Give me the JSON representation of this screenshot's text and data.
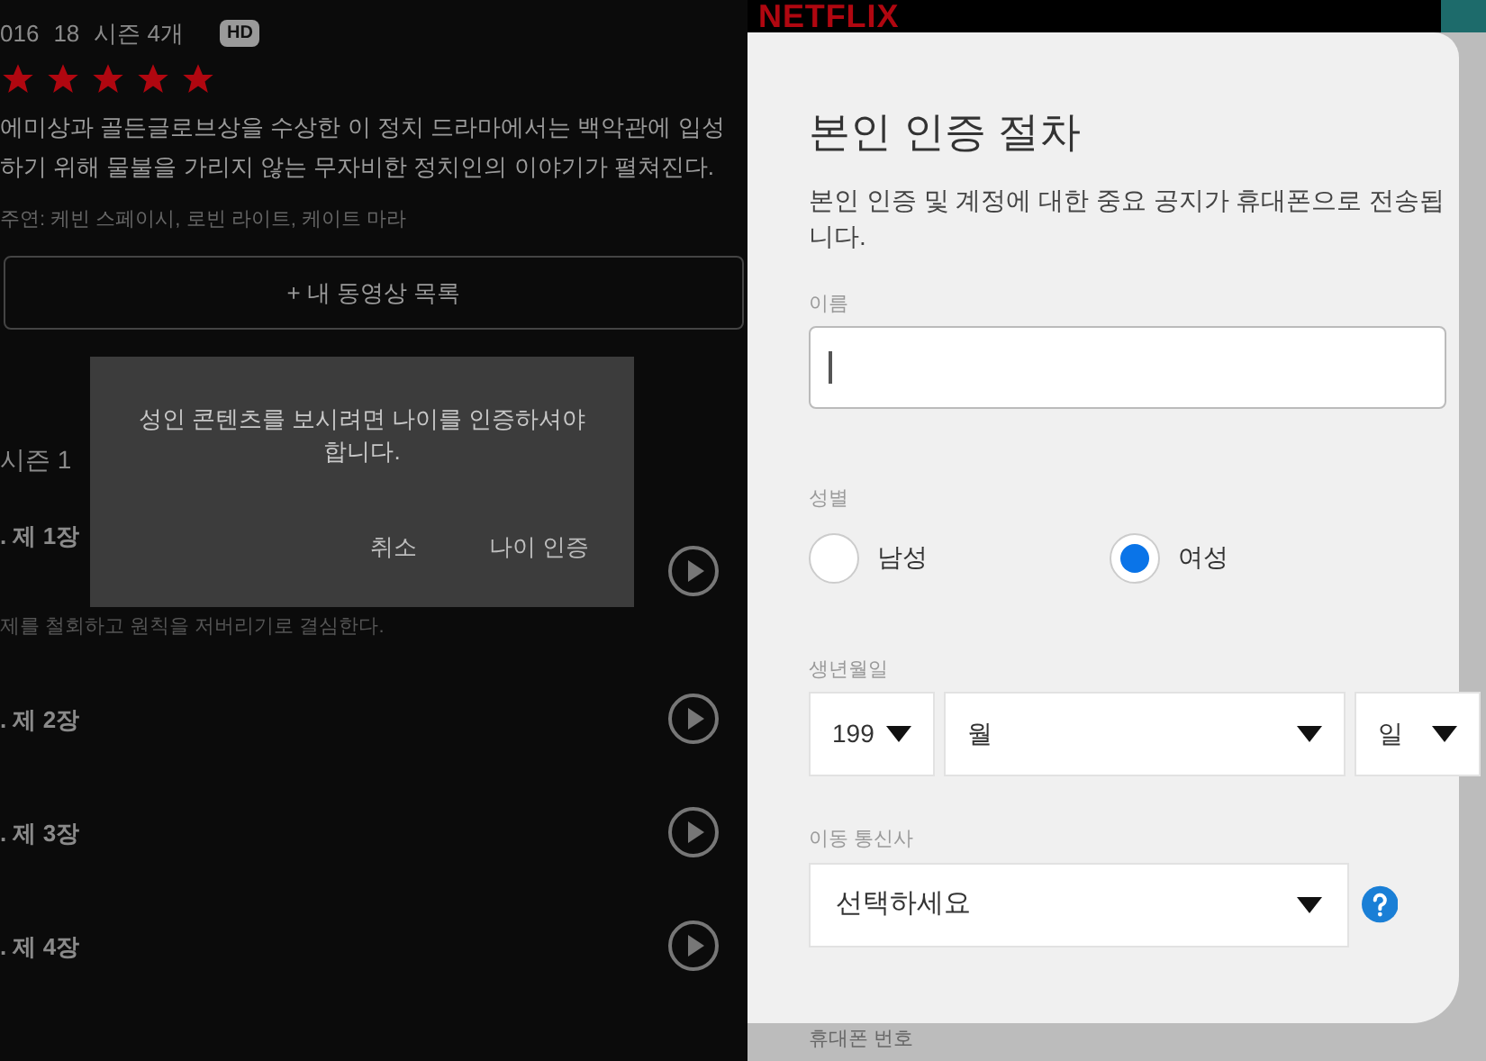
{
  "show": {
    "meta": [
      "016",
      "18",
      "시즌 4개"
    ],
    "badge": "HD",
    "stars": 5,
    "description": "에미상과 골든글로브상을 수상한 이 정치 드라마에서는 백악관에 입성하기 위해 물불을 가리지 않는 무자비한 정치인의 이야기가 펼쳐진다.",
    "cast": "주연: 케빈 스페이시, 로빈 라이트, 케이트 마라",
    "my_list_button": "+ 내 동영상 목록",
    "season": "시즌 1",
    "episodes": [
      {
        "title": ". 제 1장",
        "description": "제를 철회하고 원칙을 저버리기로 결심한다."
      },
      {
        "title": ". 제 2장"
      },
      {
        "title": ". 제 3장"
      },
      {
        "title": ". 제 4장"
      }
    ]
  },
  "dialog": {
    "message": "성인 콘텐츠를 보시려면 나이를 인증하셔야 합니다.",
    "buttons": [
      "취소",
      "나이 인증"
    ]
  },
  "logo": "NETFLIX",
  "form": {
    "title": "본인 인증 절차",
    "subtitle": "본인 인증 및 계정에 대한 중요 공지가 휴대폰으로 전송됩니다.",
    "name_label": "이름",
    "gender_label": "성별",
    "gender_options": [
      {
        "label": "남성",
        "selected": false
      },
      {
        "label": "여성",
        "selected": true
      }
    ],
    "birth_label": "생년월일",
    "birth_selects": [
      "199",
      "월",
      "일"
    ],
    "carrier_label": "이동 통신사",
    "carrier_value": "선택하세요",
    "next_label": "휴대폰 번호"
  }
}
